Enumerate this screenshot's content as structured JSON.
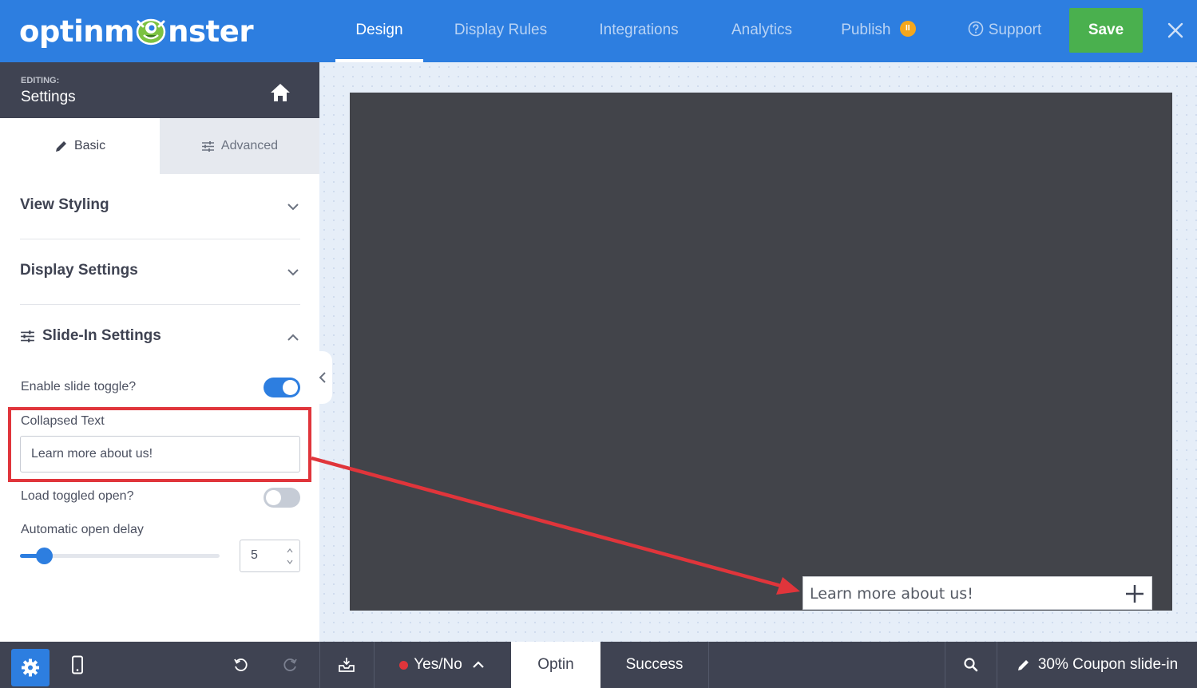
{
  "brand": {
    "logo_text_left": "optinm",
    "logo_text_right": "nster"
  },
  "topnav": {
    "items": [
      {
        "label": "Design",
        "active": true
      },
      {
        "label": "Display Rules",
        "active": false
      },
      {
        "label": "Integrations",
        "active": false
      },
      {
        "label": "Analytics",
        "active": false
      },
      {
        "label": "Publish",
        "active": false
      },
      {
        "label": "Support",
        "active": false
      }
    ],
    "publish_badge_icon": "pause-icon",
    "support_icon": "question-circle-icon",
    "save_label": "Save",
    "close_icon": "close-icon"
  },
  "sidebar": {
    "editing_label": "EDITING:",
    "editing_title": "Settings",
    "home_icon": "home-icon",
    "tabs": [
      {
        "label": "Basic",
        "icon": "pencil-icon",
        "active": true
      },
      {
        "label": "Advanced",
        "icon": "sliders-icon",
        "active": false
      }
    ],
    "sections": [
      {
        "title": "View Styling",
        "expanded": false
      },
      {
        "title": "Display Settings",
        "expanded": false
      },
      {
        "title": "Slide-In Settings",
        "expanded": true,
        "icon": "sliders-icon"
      }
    ],
    "slide_in": {
      "enable_toggle_label": "Enable slide toggle?",
      "enable_toggle_on": true,
      "collapsed_text_label": "Collapsed Text",
      "collapsed_text_value": "Learn more about us!",
      "load_open_label": "Load toggled open?",
      "load_open_on": false,
      "delay_label": "Automatic open delay",
      "delay_value": "5",
      "delay_slider_fraction": 0.12
    }
  },
  "preview": {
    "slide_text": "Learn more about us!",
    "plus_icon": "plus-icon"
  },
  "bottombar": {
    "settings_icon": "gear-icon",
    "mobile_icon": "mobile-icon",
    "undo_icon": "undo-icon",
    "redo_icon": "redo-icon",
    "save_template_icon": "inbox-download-icon",
    "view_selector": "Yes/No",
    "tabs": [
      {
        "label": "Optin",
        "active": true
      },
      {
        "label": "Success",
        "active": false
      }
    ],
    "search_icon": "search-icon",
    "campaign_name": "30% Coupon slide-in"
  },
  "colors": {
    "primary": "#2d7ee0",
    "save_green": "#4ab04e",
    "dark_panel": "#3f4352",
    "annotation_red": "#e0353b",
    "publish_badge": "#f5a71c"
  }
}
